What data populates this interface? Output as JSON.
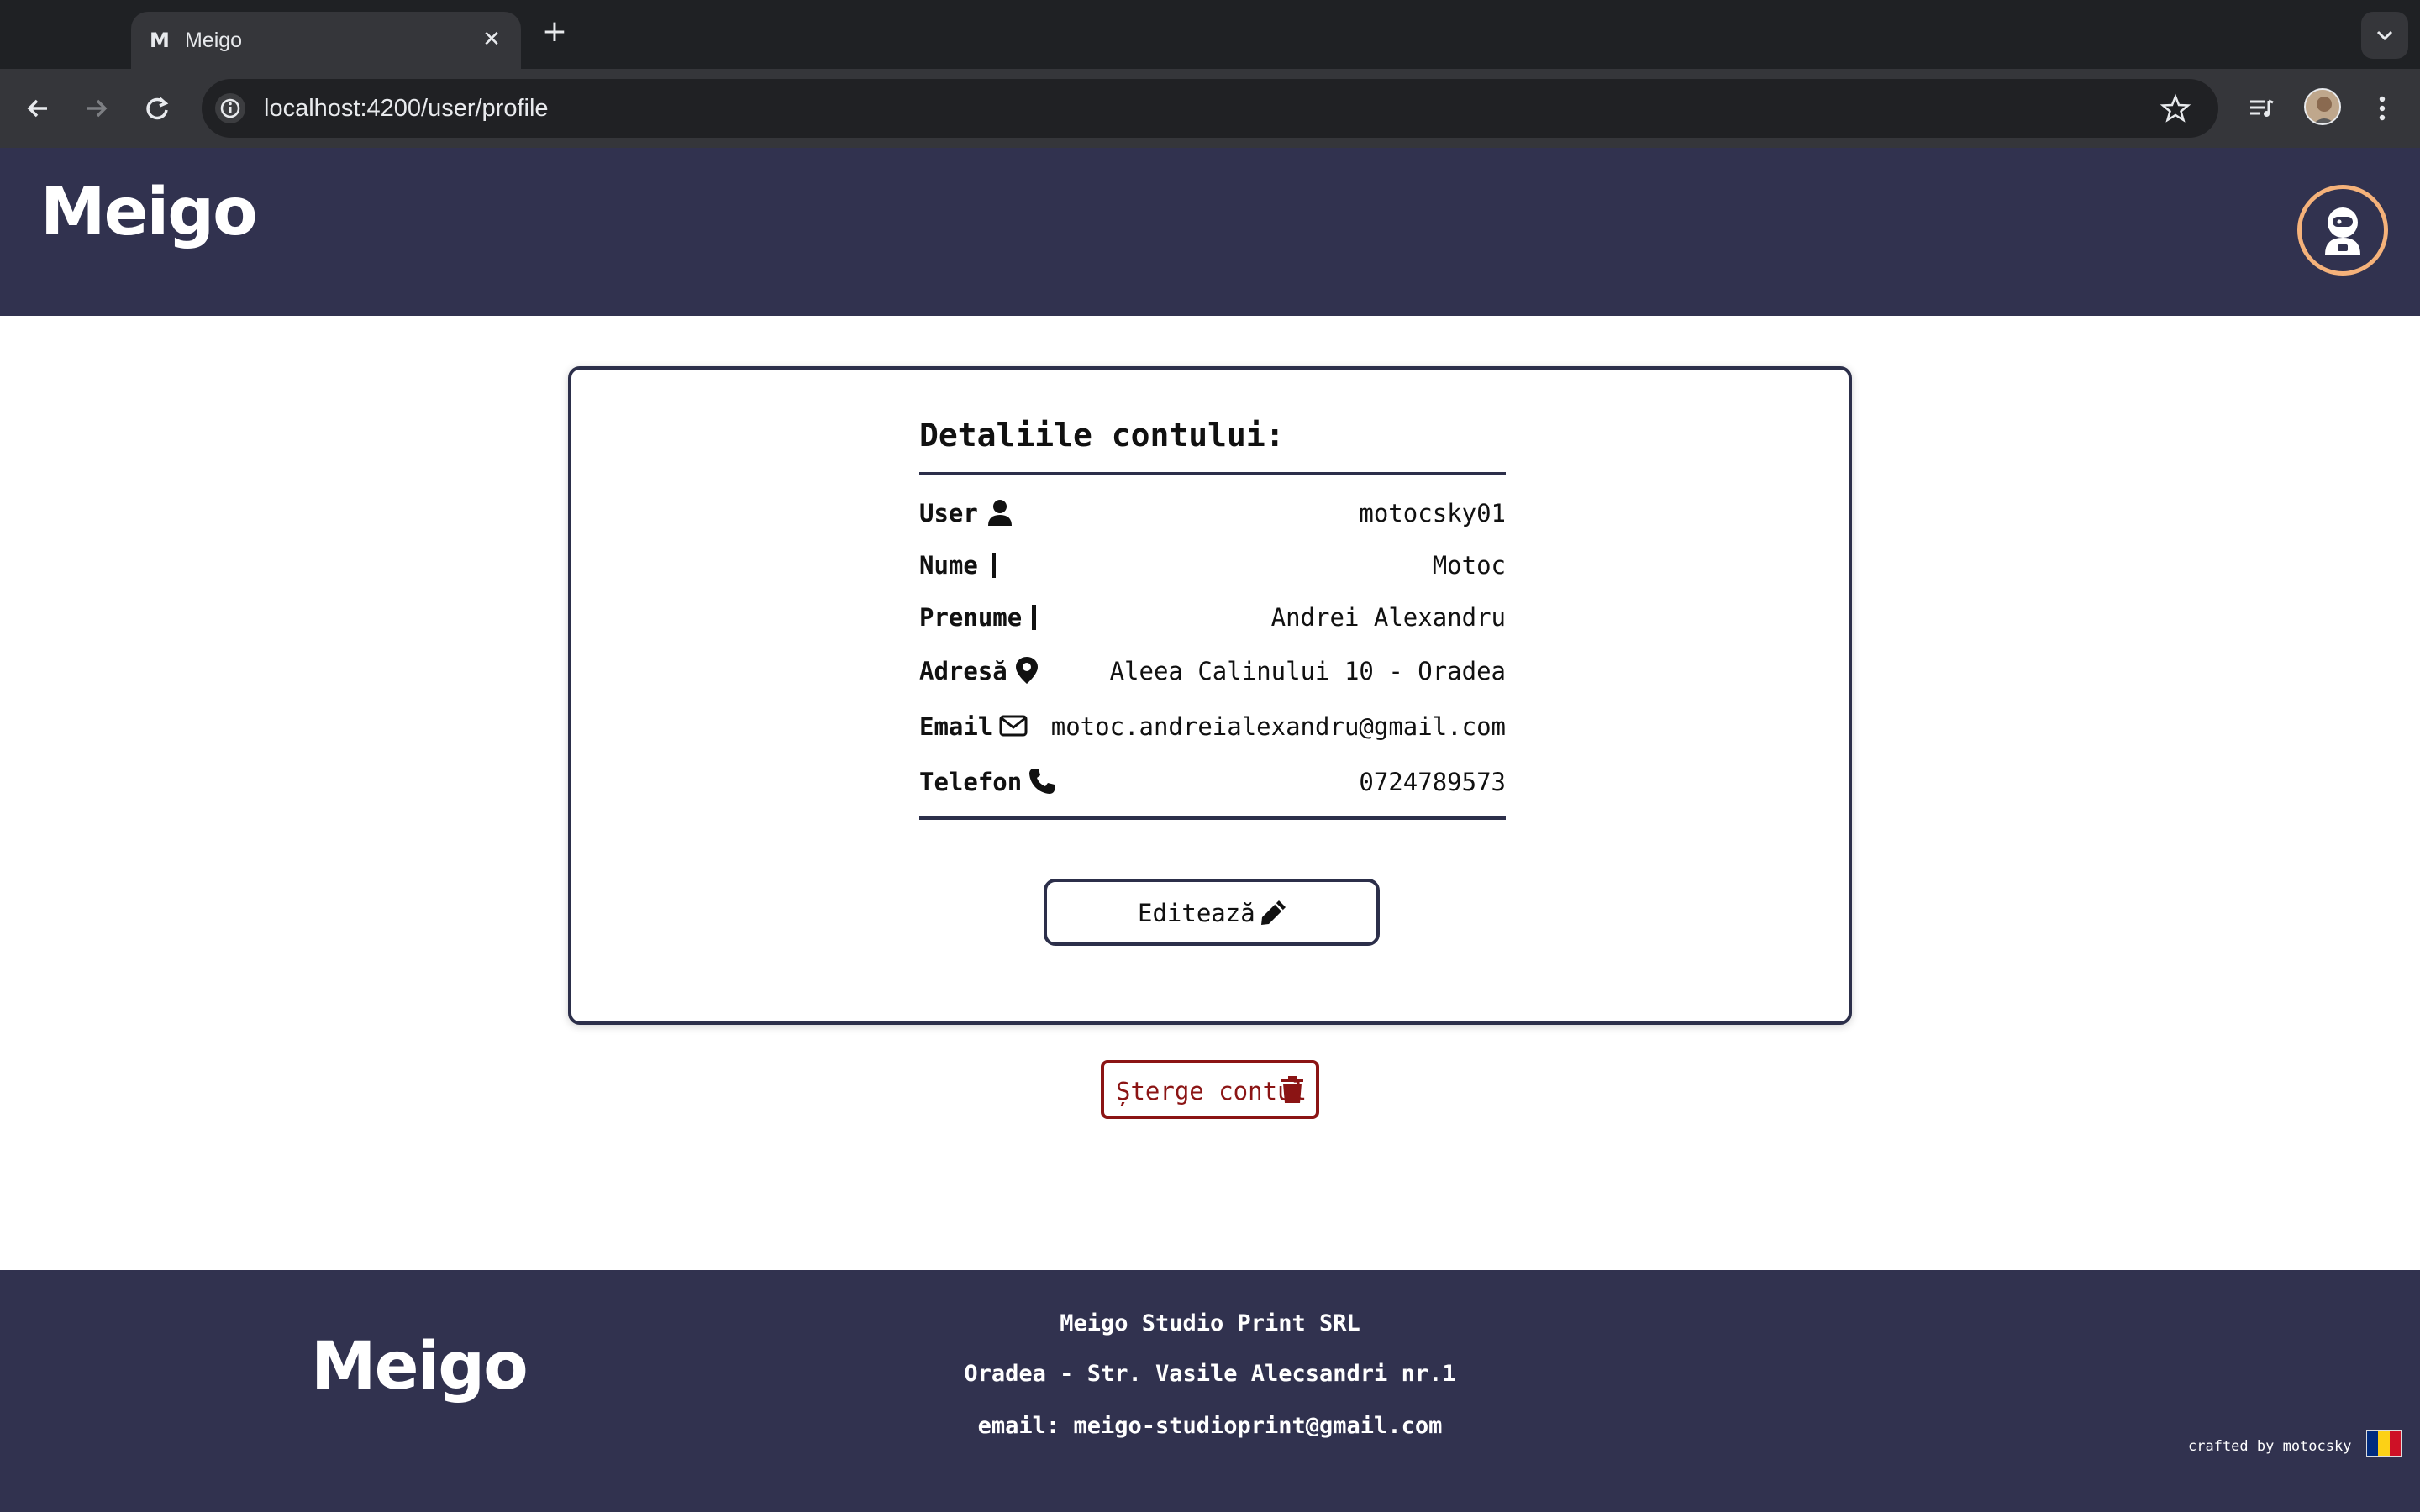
{
  "browser": {
    "tab_favicon": "M",
    "tab_title": "Meigo",
    "tab_close": "✕",
    "new_tab": "+",
    "url": "localhost:4200/user/profile",
    "icons": [
      "back-icon",
      "forward-icon",
      "reload-icon",
      "site-info-icon",
      "bookmark-star-icon",
      "media-controls-icon",
      "profile-avatar",
      "menu-kebab-icon",
      "tab-search-chevron-icon"
    ]
  },
  "header": {
    "logo": "Meigo",
    "avatar_icon": "astronaut-icon"
  },
  "profile": {
    "title": "Detaliile contului:",
    "rows": [
      {
        "label": "User",
        "value": "motocsky01",
        "icon": "user-icon"
      },
      {
        "label": "Nume",
        "value": "Motoc",
        "icon": "bar"
      },
      {
        "label": "Prenume",
        "value": "Andrei Alexandru",
        "icon": "bar"
      },
      {
        "label": "Adresă",
        "value": "Aleea Calinului 10 - Oradea",
        "icon": "map-pin-icon"
      },
      {
        "label": "Email",
        "value": "motoc.andreialexandru@gmail.com",
        "icon": "envelope-icon"
      },
      {
        "label": "Telefon",
        "value": "0724789573",
        "icon": "phone-icon"
      }
    ],
    "edit_label": "Editează",
    "delete_label": "Șterge contul"
  },
  "footer": {
    "logo": "Meigo",
    "company": "Meigo Studio Print SRL",
    "address": "Oradea - Str. Vasile Alecsandri nr.1",
    "email": "email: meigo-studioprint@gmail.com",
    "crafted": "crafted by motocsky",
    "flag_colors": [
      "#002b7f",
      "#fcd116",
      "#ce1126"
    ]
  }
}
